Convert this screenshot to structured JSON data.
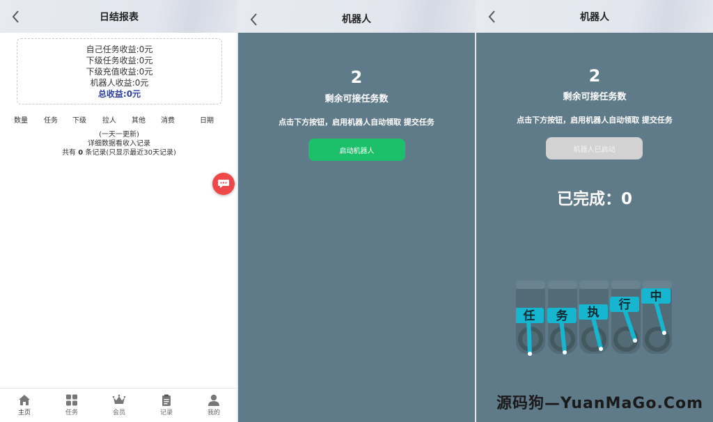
{
  "report": {
    "title": "日结报表",
    "summary": [
      "自己任务收益:0元",
      "下级任务收益:0元",
      "下级充值收益:0元",
      "机器人收益:0元"
    ],
    "total": "总收益:0元",
    "columns": [
      "数量",
      "任务",
      "下级",
      "拉人",
      "其他",
      "消费",
      "日期"
    ],
    "notes": [
      "(一天一更新)",
      "详细数据看收入记录"
    ],
    "records_prefix": "共有",
    "records_count": "0",
    "records_suffix": "条记录(只显示最近30天记录)",
    "fab_icon": "chat-bubble-icon",
    "tabs": [
      {
        "label": "主页",
        "icon": "home-icon"
      },
      {
        "label": "任务",
        "icon": "grid-icon"
      },
      {
        "label": "会员",
        "icon": "crown-icon"
      },
      {
        "label": "记录",
        "icon": "clipboard-icon"
      },
      {
        "label": "我的",
        "icon": "user-icon"
      }
    ]
  },
  "robot_idle": {
    "title": "机器人",
    "count": "2",
    "subtitle": "剩余可接任务数",
    "hint": "点击下方按钮，启用机器人自动领取 提交任务",
    "button_label": "启动机器人"
  },
  "robot_running": {
    "title": "机器人",
    "count": "2",
    "subtitle": "剩余可接任务数",
    "hint": "点击下方按钮，启用机器人自动领取 提交任务",
    "button_label": "机器人已启动",
    "completed": "已完成：0",
    "running_chars": [
      "任",
      "务",
      "执",
      "行",
      "中"
    ]
  },
  "watermark": "源码狗—YuanMaGo.Com",
  "colors": {
    "panel_bg": "#5f7a88",
    "start_button": "#1dc06a",
    "started_button": "#d2d2d2",
    "fab": "#f04848",
    "total_text": "#2c3e9e",
    "tile": "#16b6d1"
  }
}
